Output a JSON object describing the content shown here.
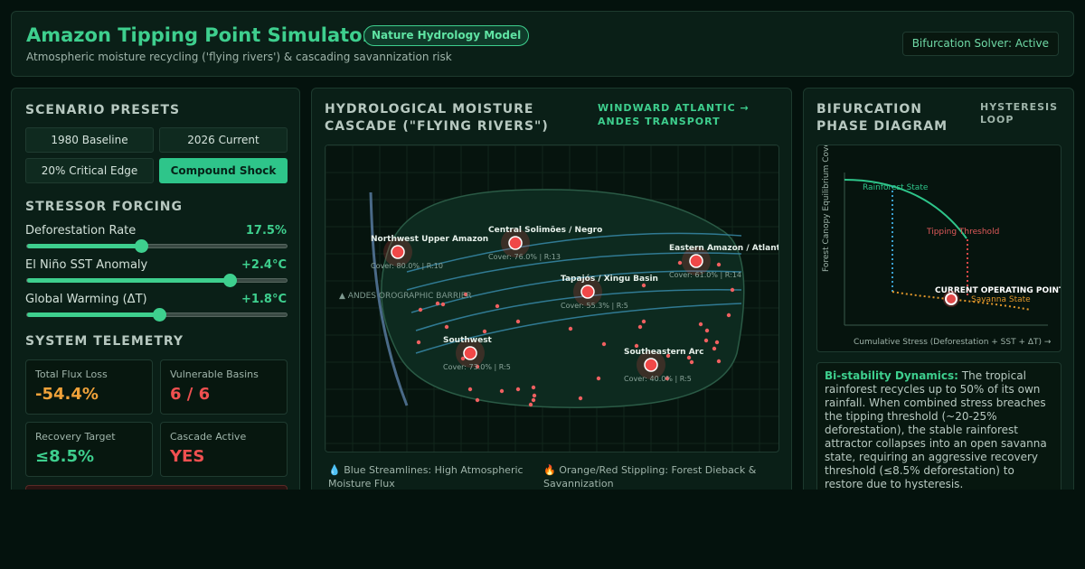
{
  "header": {
    "title": "Amazon Tipping Point Simulator",
    "model_badge": "Nature Hydrology Model",
    "subtitle": "Atmospheric moisture recycling ('flying rivers') & cascading savannization risk",
    "solver_status": "Bifurcation Solver: Active"
  },
  "presets": {
    "title": "SCENARIO PRESETS",
    "buttons": [
      {
        "label": "1980 Baseline",
        "active": false
      },
      {
        "label": "2026 Current",
        "active": false
      },
      {
        "label": "20% Critical Edge",
        "active": false
      },
      {
        "label": "Compound Shock",
        "active": true
      }
    ]
  },
  "stressors": {
    "title": "STRESSOR FORCING",
    "sliders": [
      {
        "label": "Deforestation Rate",
        "value": "17.5%",
        "fraction": 0.44
      },
      {
        "label": "El Niño SST Anomaly",
        "value": "+2.4°C",
        "fraction": 0.78
      },
      {
        "label": "Global Warming (ΔT)",
        "value": "+1.8°C",
        "fraction": 0.51
      }
    ]
  },
  "telemetry": {
    "title": "SYSTEM TELEMETRY",
    "cards": [
      {
        "label": "Total Flux Loss",
        "value": "-54.4%",
        "color": "#f0a23a"
      },
      {
        "label": "Vulnerable Basins",
        "value": "6 / 6",
        "color": "#f05050"
      },
      {
        "label": "Recovery Target",
        "value": "≤8.5%",
        "color": "#3ecf8e"
      },
      {
        "label": "Cascade Active",
        "value": "YES",
        "color": "#f05050"
      }
    ]
  },
  "cascade": {
    "title": "HYDROLOGICAL MOISTURE CASCADE (\"FLYING RIVERS\")",
    "subtitle": "WINDWARD ATLANTIC → ANDES TRANSPORT",
    "andes_label": "▲ ANDES OROGRAPHIC BARRIER",
    "basins": [
      {
        "name": "Northwest Upper Amazon",
        "stats": "Cover: 80.0% | R:10"
      },
      {
        "name": "Central Solimões / Negro",
        "stats": "Cover: 76.0% | R:13"
      },
      {
        "name": "Eastern Amazon / Atlantic",
        "stats": "Cover: 61.0% | R:14"
      },
      {
        "name": "Tapajós / Xingu Basin",
        "stats": "Cover: 55.3% | R:5"
      },
      {
        "name": "Southwest",
        "stats": "Cover: 73.0% | R:5"
      },
      {
        "name": "Southeastern Arc",
        "stats": "Cover: 40.0% | R:5"
      }
    ],
    "legend": [
      {
        "icon": "💧",
        "text": "Blue Streamlines: High Atmospheric Moisture Flux"
      },
      {
        "icon": "🔥",
        "text": "Orange/Red Stippling: Forest Dieback & Savannization"
      }
    ],
    "colors": {
      "streamline": "#3a8fb0",
      "basin": "#f04848",
      "stipple": "#f06060"
    }
  },
  "phase": {
    "title": "BIFURCATION PHASE DIAGRAM",
    "subtitle": "HYSTERESIS LOOP",
    "y_axis": "Forest Canopy Equilibrium Cover",
    "x_axis": "Cumulative Stress (Deforestation + SST + ΔT) →",
    "rainforest_label": "Rainforest State",
    "threshold_label": "Tipping Threshold",
    "operating_label": "CURRENT OPERATING POINT",
    "savanna_label": "Savanna State"
  },
  "dynamics": {
    "heading": "Bi-stability Dynamics:",
    "text": "The tropical rainforest recycles up to 50% of its own rainfall. When combined stress breaches the tipping threshold (~20-25% deforestation), the stable rainforest attractor collapses into an open savanna state, requiring an aggressive recovery threshold (≤8.5% deforestation) to restore due to hysteresis."
  }
}
